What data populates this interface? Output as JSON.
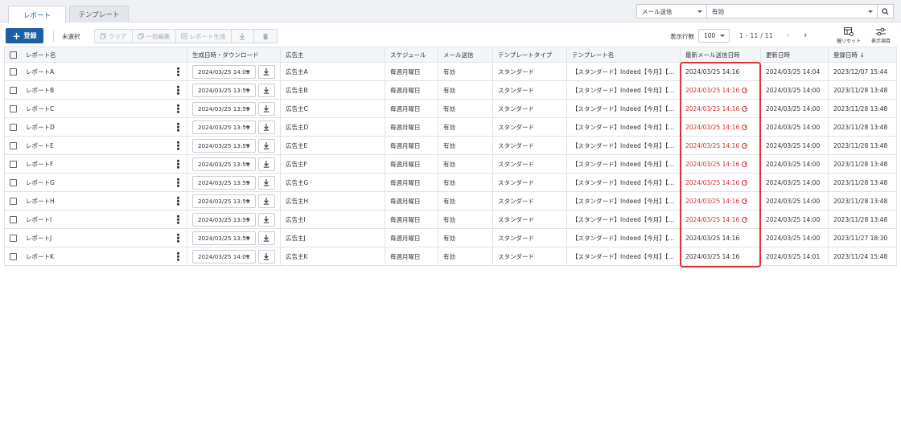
{
  "tabs": [
    {
      "label": "レポート",
      "active": true
    },
    {
      "label": "テンプレート",
      "active": false
    }
  ],
  "filter": {
    "field": "メール送信",
    "value": "有効",
    "search_icon": "search-icon"
  },
  "toolbar": {
    "add_label": "登録",
    "selection_status": "未選択",
    "clear_label": "クリア",
    "bulk_edit_label": "一括編集",
    "generate_label": "レポート生成",
    "rows_label": "表示行数",
    "rows_value": "100",
    "pager_text": "1 - 11 / 11",
    "reset_label": "幅リセット",
    "columns_label": "表示項目"
  },
  "table": {
    "headers": {
      "name": "レポート名",
      "generated": "生成日時・ダウンロード",
      "advertiser": "広告主",
      "schedule": "スケジュール",
      "mail": "メール送信",
      "template_type": "テンプレートタイプ",
      "template_name": "テンプレート名",
      "last_mail": "最新メール送信日時",
      "updated": "更新日時",
      "created": "登録日時 ↓"
    },
    "rows": [
      {
        "name": "レポートA",
        "generated": "2024/03/25 14:03",
        "advertiser": "広告主A",
        "schedule": "毎週月曜日",
        "mail": "有効",
        "template_type": "スタンダード",
        "template_name": "【スタンダード】Indeed【今月】【F...",
        "last_mail": "2024/03/25 14:16",
        "last_mail_error": false,
        "updated": "2024/03/25 14:04",
        "created": "2023/12/07 15:44"
      },
      {
        "name": "レポートB",
        "generated": "2024/03/25 13:59",
        "advertiser": "広告主B",
        "schedule": "毎週月曜日",
        "mail": "有効",
        "template_type": "スタンダード",
        "template_name": "【スタンダード】Indeed【今月】【F...",
        "last_mail": "2024/03/25 14:16",
        "last_mail_error": true,
        "updated": "2024/03/25 14:00",
        "created": "2023/11/28 13:48"
      },
      {
        "name": "レポートC",
        "generated": "2024/03/25 13:59",
        "advertiser": "広告主C",
        "schedule": "毎週月曜日",
        "mail": "有効",
        "template_type": "スタンダード",
        "template_name": "【スタンダード】Indeed【今月】【F...",
        "last_mail": "2024/03/25 14:16",
        "last_mail_error": true,
        "updated": "2024/03/25 14:00",
        "created": "2023/11/28 13:48"
      },
      {
        "name": "レポートD",
        "generated": "2024/03/25 13:59",
        "advertiser": "広告主D",
        "schedule": "毎週月曜日",
        "mail": "有効",
        "template_type": "スタンダード",
        "template_name": "【スタンダード】Indeed【今月】【F...",
        "last_mail": "2024/03/25 14:16",
        "last_mail_error": true,
        "updated": "2024/03/25 14:00",
        "created": "2023/11/28 13:48"
      },
      {
        "name": "レポートE",
        "generated": "2024/03/25 13:59",
        "advertiser": "広告主E",
        "schedule": "毎週月曜日",
        "mail": "有効",
        "template_type": "スタンダード",
        "template_name": "【スタンダード】Indeed【今月】【F...",
        "last_mail": "2024/03/25 14:16",
        "last_mail_error": true,
        "updated": "2024/03/25 14:00",
        "created": "2023/11/28 13:48"
      },
      {
        "name": "レポートF",
        "generated": "2024/03/25 13:59",
        "advertiser": "広告主F",
        "schedule": "毎週月曜日",
        "mail": "有効",
        "template_type": "スタンダード",
        "template_name": "【スタンダード】Indeed【今月】【F...",
        "last_mail": "2024/03/25 14:16",
        "last_mail_error": true,
        "updated": "2024/03/25 14:00",
        "created": "2023/11/28 13:48"
      },
      {
        "name": "レポートG",
        "generated": "2024/03/25 13:59",
        "advertiser": "広告主G",
        "schedule": "毎週月曜日",
        "mail": "有効",
        "template_type": "スタンダード",
        "template_name": "【スタンダード】Indeed【今月】【F...",
        "last_mail": "2024/03/25 14:16",
        "last_mail_error": true,
        "updated": "2024/03/25 14:00",
        "created": "2023/11/28 13:48"
      },
      {
        "name": "レポートH",
        "generated": "2024/03/25 13:59",
        "advertiser": "広告主H",
        "schedule": "毎週月曜日",
        "mail": "有効",
        "template_type": "スタンダード",
        "template_name": "【スタンダード】Indeed【今月】【F...",
        "last_mail": "2024/03/25 14:16",
        "last_mail_error": true,
        "updated": "2024/03/25 14:00",
        "created": "2023/11/28 13:48"
      },
      {
        "name": "レポートI",
        "generated": "2024/03/25 13:59",
        "advertiser": "広告主I",
        "schedule": "毎週月曜日",
        "mail": "有効",
        "template_type": "スタンダード",
        "template_name": "【スタンダード】Indeed【今月】【F...",
        "last_mail": "2024/03/25 14:16",
        "last_mail_error": true,
        "updated": "2024/03/25 14:00",
        "created": "2023/11/28 13:48"
      },
      {
        "name": "レポートJ",
        "generated": "2024/03/25 13:59",
        "advertiser": "広告主J",
        "schedule": "毎週月曜日",
        "mail": "有効",
        "template_type": "スタンダード",
        "template_name": "【スタンダード】Indeed【今月】【F...",
        "last_mail": "2024/03/25 14:16",
        "last_mail_error": false,
        "updated": "2024/03/25 14:00",
        "created": "2023/11/27 18:30"
      },
      {
        "name": "レポートK",
        "generated": "2024/03/25 14:01",
        "advertiser": "広告主K",
        "schedule": "毎週月曜日",
        "mail": "有効",
        "template_type": "スタンダード",
        "template_name": "【スタンダード】Indeed【今月】【F...",
        "last_mail": "2024/03/25 14:16",
        "last_mail_error": false,
        "updated": "2024/03/25 14:01",
        "created": "2023/11/24 15:48"
      }
    ]
  },
  "colors": {
    "primary": "#1d5fa3",
    "error": "#d02f2f",
    "highlight": "#e0313a"
  }
}
